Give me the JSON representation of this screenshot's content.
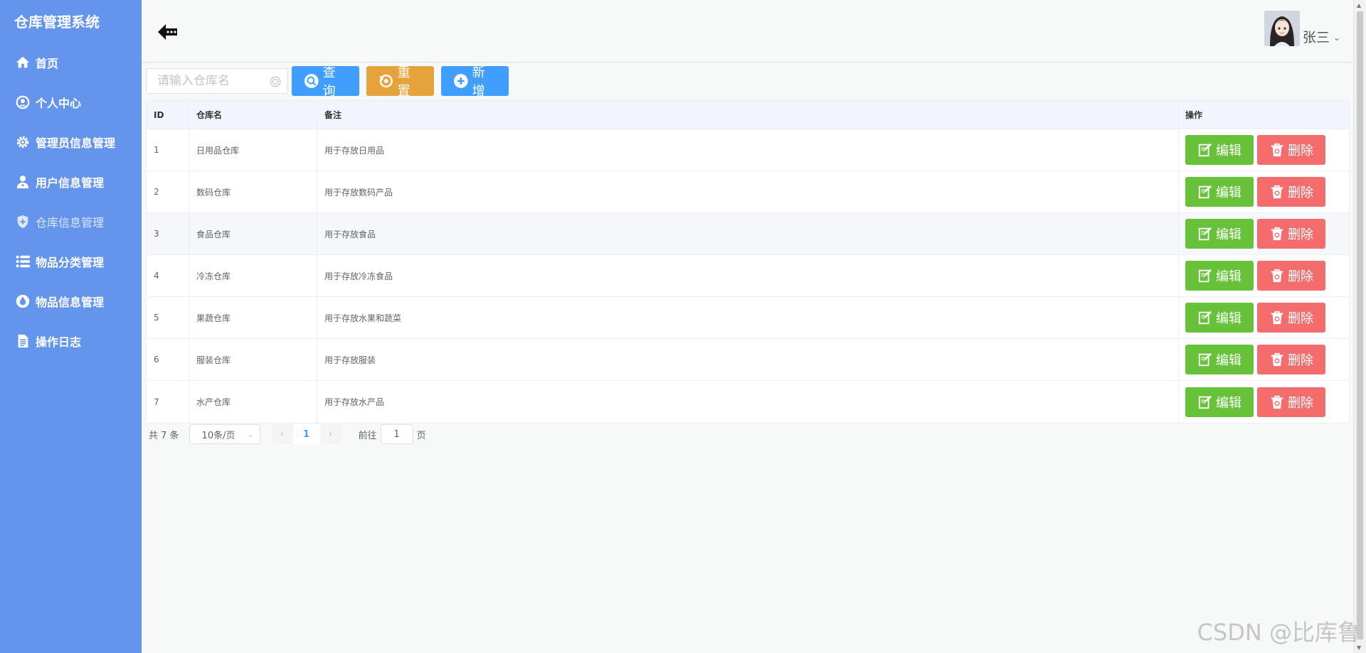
{
  "sidebar": {
    "title": "仓库管理系统",
    "items": [
      {
        "label": "首页",
        "icon": "home-icon"
      },
      {
        "label": "个人中心",
        "icon": "user-circle-icon"
      },
      {
        "label": "管理员信息管理",
        "icon": "gear-icon"
      },
      {
        "label": "用户信息管理",
        "icon": "user-icon"
      },
      {
        "label": "仓库信息管理",
        "icon": "warehouse-icon",
        "active": true
      },
      {
        "label": "物品分类管理",
        "icon": "list-icon"
      },
      {
        "label": "物品信息管理",
        "icon": "drop-icon"
      },
      {
        "label": "操作日志",
        "icon": "document-icon"
      }
    ]
  },
  "header": {
    "username": "张三"
  },
  "toolbar": {
    "search_placeholder": "请输入仓库名",
    "search_value": "",
    "query_label": "查询",
    "reset_label": "重置",
    "add_label": "新增"
  },
  "table": {
    "headers": {
      "id": "ID",
      "name": "仓库名",
      "remark": "备注",
      "ops": "操作"
    },
    "rows": [
      {
        "id": "1",
        "name": "日用品仓库",
        "remark": "用于存放日用品"
      },
      {
        "id": "2",
        "name": "数码仓库",
        "remark": "用于存放数码产品"
      },
      {
        "id": "3",
        "name": "食品仓库",
        "remark": "用于存放食品"
      },
      {
        "id": "4",
        "name": "冷冻仓库",
        "remark": "用于存放冷冻食品"
      },
      {
        "id": "5",
        "name": "果蔬仓库",
        "remark": "用于存放水果和蔬菜"
      },
      {
        "id": "6",
        "name": "服装仓库",
        "remark": "用于存放服装"
      },
      {
        "id": "7",
        "name": "水产仓库",
        "remark": "用于存放水产品"
      }
    ],
    "edit_label": "编辑",
    "delete_label": "删除"
  },
  "pagination": {
    "total_text": "共 7 条",
    "page_size": "10条/页",
    "current_page": "1",
    "goto_prefix": "前往",
    "goto_value": "1",
    "goto_suffix": "页"
  },
  "watermark": "CSDN @比库鲁",
  "colors": {
    "sidebar_bg": "#6495ed",
    "primary": "#409eff",
    "warning": "#e6a23c",
    "success": "#67c23a",
    "danger": "#f56c6c"
  }
}
